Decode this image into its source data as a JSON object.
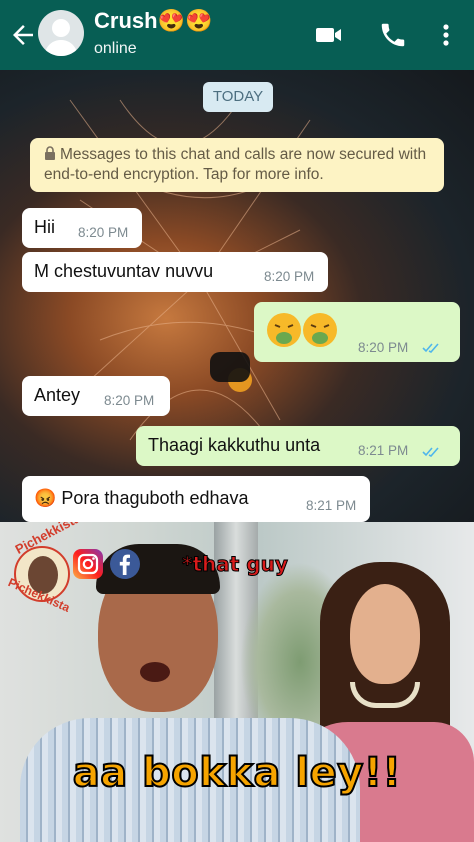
{
  "header": {
    "title": "Crush😍😍",
    "status": "online",
    "background": "#075e54"
  },
  "chat": {
    "date_chip": "TODAY",
    "encryption_notice": "Messages to this chat and calls are now secured with end-to-end encryption. Tap for more info.",
    "messages": [
      {
        "direction": "in",
        "text": "Hii",
        "time": "8:20 PM"
      },
      {
        "direction": "in",
        "text": "M chestuvuntav nuvvu",
        "time": "8:20 PM"
      },
      {
        "direction": "out",
        "text": "🤮🤮",
        "time": "8:20 PM",
        "read": true
      },
      {
        "direction": "in",
        "text": "Antey",
        "time": "8:20 PM"
      },
      {
        "direction": "out",
        "text": "Thaagi kakkuthu unta",
        "time": "8:21 PM",
        "read": true
      },
      {
        "direction": "in",
        "text": "😡 Pora thaguboth edhava",
        "time": "8:21 PM"
      }
    ],
    "colors": {
      "incoming": "#ffffff",
      "outgoing": "#dcf8c6",
      "read_ticks": "#4fb6ec"
    }
  },
  "meme": {
    "watermark_top": "Pichekkista",
    "watermark_bottom": "Pichekkista",
    "label": "*that guy",
    "caption": "aa bokka ley!!",
    "icons": [
      "instagram-icon",
      "facebook-icon"
    ],
    "caption_color": "#f6a400",
    "label_color": "#d91b1b"
  }
}
